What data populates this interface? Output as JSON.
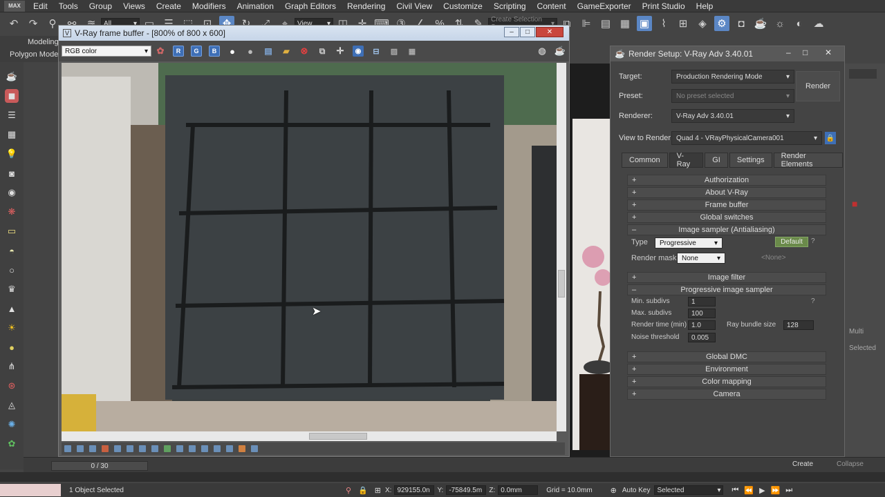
{
  "app": {
    "logo_text": "MAX"
  },
  "menubar": {
    "items": [
      "Edit",
      "Tools",
      "Group",
      "Views",
      "Create",
      "Modifiers",
      "Animation",
      "Graph Editors",
      "Rendering",
      "Civil View",
      "Customize",
      "Scripting",
      "Content",
      "GameExporter",
      "Print Studio",
      "Help"
    ]
  },
  "toolbar": {
    "selection_filter": "All",
    "ref_coord": "View",
    "named_selection_placeholder": "Create Selection Se"
  },
  "ribbon": {
    "tab1": "Modeling",
    "tab2": "Polygon Mode"
  },
  "vfb": {
    "title": "V-Ray frame buffer - [800% of 800 x 600]",
    "channel": "RGB color",
    "r_label": "R",
    "g_label": "G",
    "b_label": "B"
  },
  "render_setup": {
    "title": "Render Setup: V-Ray Adv 3.40.01",
    "target_label": "Target:",
    "target_value": "Production Rendering Mode",
    "preset_label": "Preset:",
    "preset_value": "No preset selected",
    "renderer_label": "Renderer:",
    "renderer_value": "V-Ray Adv 3.40.01",
    "view_label": "View to Render:",
    "view_value": "Quad 4 - VRayPhysicalCamera001",
    "render_button": "Render",
    "tabs": [
      "Common",
      "V-Ray",
      "GI",
      "Settings",
      "Render Elements"
    ],
    "rollouts_top": [
      "Authorization",
      "About V-Ray",
      "Frame buffer",
      "Global switches",
      "Image sampler (Antialiasing)"
    ],
    "type_label": "Type",
    "type_value": "Progressive",
    "default_label": "Default",
    "help_label": "?",
    "render_mask_label": "Render mask",
    "render_mask_value": "None",
    "render_mask_none": "<None>",
    "image_filter": "Image filter",
    "prog_sampler": "Progressive image sampler",
    "min_subdivs_label": "Min. subdivs",
    "min_subdivs": "1",
    "max_subdivs_label": "Max. subdivs",
    "max_subdivs": "100",
    "render_time_label": "Render time (min)",
    "render_time": "1.0",
    "ray_bundle_label": "Ray bundle size",
    "ray_bundle": "128",
    "noise_label": "Noise threshold",
    "noise": "0.005",
    "rollouts_bottom": [
      "Global DMC",
      "Environment",
      "Color mapping",
      "Camera"
    ]
  },
  "right_panel": {
    "multi": "Multi",
    "selected": "Selected",
    "create": "Create",
    "collapse": "Collapse"
  },
  "timeline": {
    "frame": "0 / 30"
  },
  "status": {
    "objects": "1 Object Selected",
    "x_label": "X:",
    "x_value": "929155.0n",
    "y_label": "Y:",
    "y_value": "-75849.5m",
    "z_label": "Z:",
    "z_value": "0.0mm",
    "grid": "Grid = 10.0mm",
    "auto_key": "Auto Key",
    "key_mode": "Selected"
  }
}
